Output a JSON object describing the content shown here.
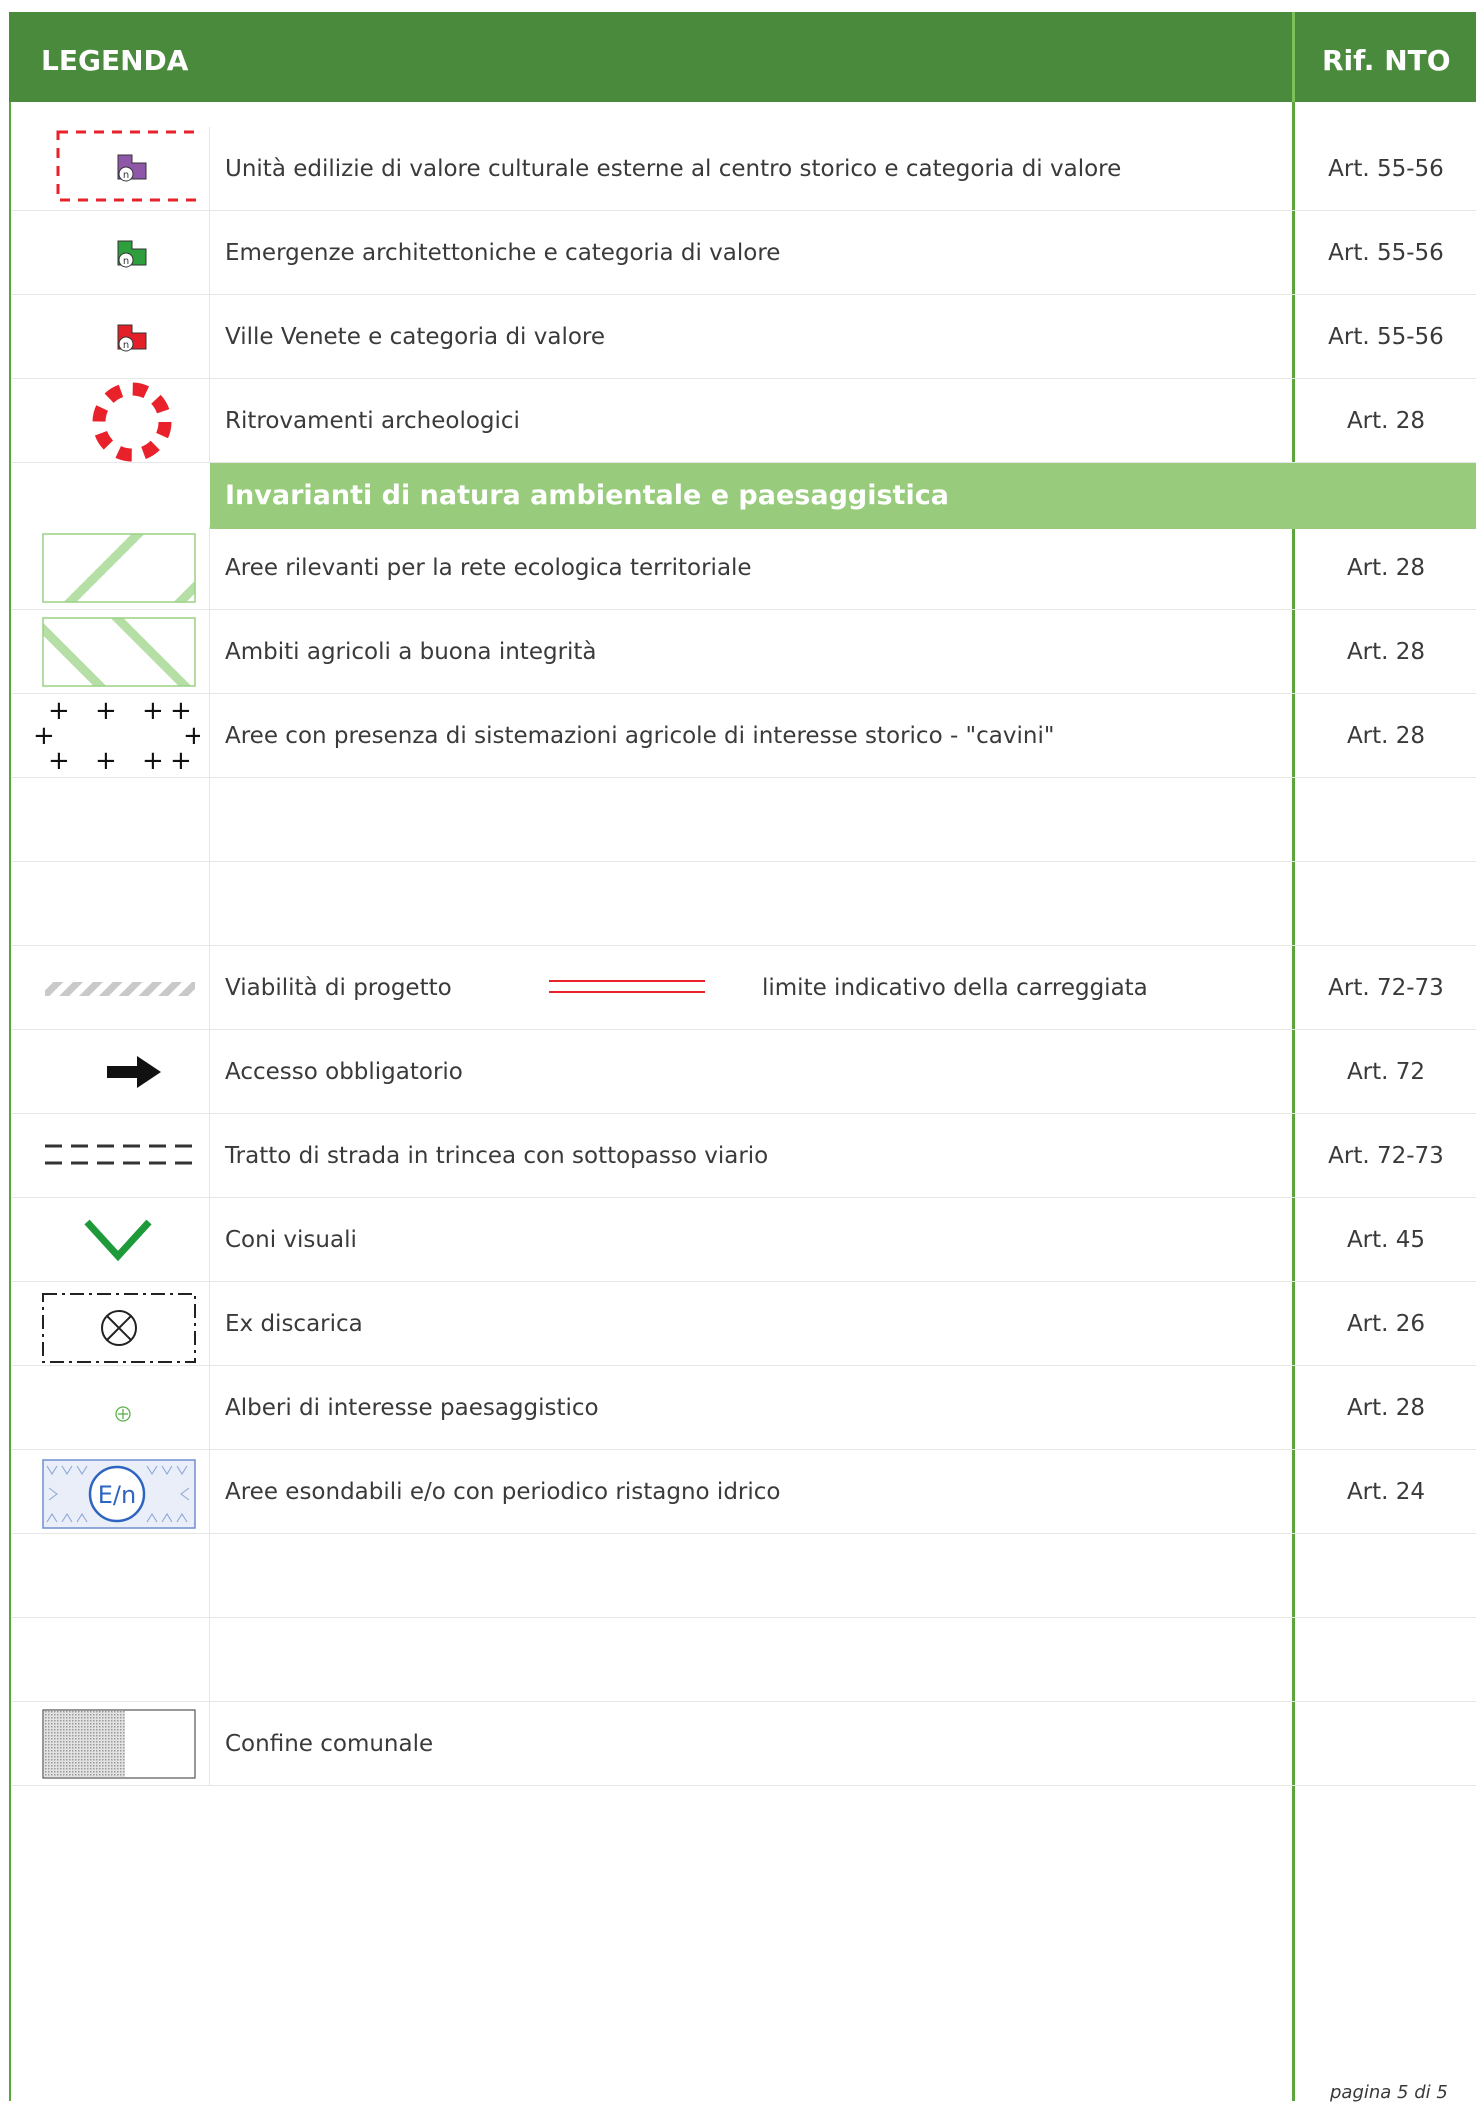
{
  "header": {
    "title": "LEGENDA",
    "ref_title": "Rif. NTO"
  },
  "rows_a": [
    {
      "symbol": "purple-building-icon",
      "label": "Unità edilizie di valore culturale esterne al centro storico e categoria di valore",
      "ref": "Art. 55-56"
    },
    {
      "symbol": "green-building-icon",
      "label": "Emergenze architettoniche e categoria di valore",
      "ref": "Art. 55-56"
    },
    {
      "symbol": "red-building-icon",
      "label": "Ville Venete e categoria di valore",
      "ref": "Art. 55-56"
    },
    {
      "symbol": "dashed-red-circle-icon",
      "label": "Ritrovamenti archeologici",
      "ref": "Art. 28"
    }
  ],
  "section": {
    "title": "Invarianti di natura ambientale e paesaggistica"
  },
  "rows_b": [
    {
      "symbol": "green-diagonal-hatch-icon",
      "label": "Aree rilevanti per la rete ecologica territoriale",
      "ref": "Art. 28"
    },
    {
      "symbol": "green-back-hatch-icon",
      "label": "Ambiti agricoli a buona integrità",
      "ref": "Art. 28"
    },
    {
      "symbol": "black-crosses-icon",
      "label": "Aree con presenza di sistemazioni agricole di interesse storico - \"cavini\"",
      "ref": "Art. 28"
    },
    {
      "symbol": "",
      "label": "",
      "ref": ""
    },
    {
      "symbol": "",
      "label": "",
      "ref": ""
    },
    {
      "symbol": "grey-striped-road-icon",
      "label": "Viabilità di progetto",
      "label2": "limite indicativo della carreggiata",
      "extra_symbol": "red-double-line-icon",
      "ref": "Art. 72-73"
    },
    {
      "symbol": "black-arrow-icon",
      "label": "Accesso obbligatorio",
      "ref": "Art. 72"
    },
    {
      "symbol": "dashed-double-line-icon",
      "label": "Tratto di strada in trincea con sottopasso viario",
      "ref": "Art. 72-73"
    },
    {
      "symbol": "green-v-icon",
      "label": "Coni visuali",
      "ref": "Art. 45"
    },
    {
      "symbol": "dashed-box-cross-circle-icon",
      "label": "Ex discarica",
      "ref": "Art. 26"
    },
    {
      "symbol": "green-tree-circle-icon",
      "label": "Alberi di interesse paesaggistico",
      "ref": "Art. 28"
    },
    {
      "symbol": "flood-area-icon",
      "symbol_text": "E/n",
      "label": "Aree esondabili e/o con periodico ristagno idrico",
      "ref": "Art. 24"
    },
    {
      "symbol": "",
      "label": "",
      "ref": ""
    },
    {
      "symbol": "",
      "label": "",
      "ref": ""
    },
    {
      "symbol": "municipal-boundary-icon",
      "label": "Confine comunale",
      "ref": ""
    }
  ],
  "footer": {
    "page": "pagina 5 di 5"
  },
  "colors": {
    "header": "#4a8a3c",
    "section": "#98cc7c",
    "frame": "#5aa53c"
  }
}
